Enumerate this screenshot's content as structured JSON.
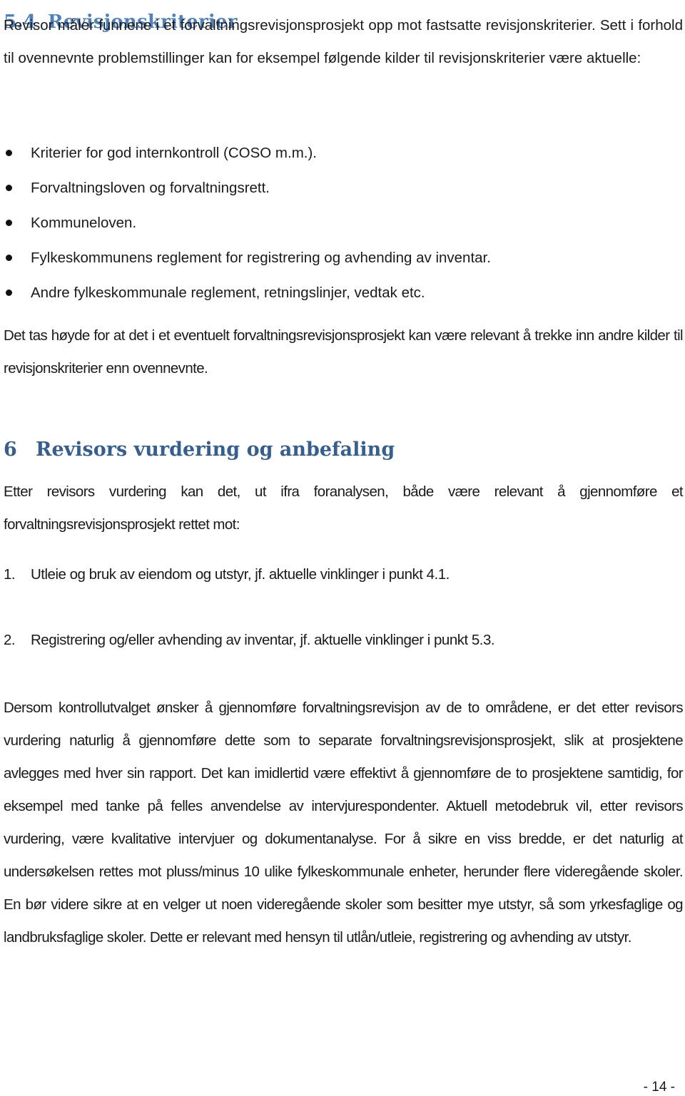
{
  "section_5_4": {
    "number": "5.4",
    "title": "Revisjonskriterier",
    "intro": "Revisor måler funnene i et forvaltningsrevisjonsprosjekt opp mot fastsatte revisjonskriterier. Sett i forhold til ovennevnte problemstillinger kan for eksempel følgende kilder til revisjonskriterier være aktuelle:",
    "bullets": [
      "Kriterier for god internkontroll (COSO m.m.).",
      "Forvaltningsloven og forvaltningsrett.",
      "Kommuneloven.",
      "Fylkeskommunens reglement for registrering og avhending av inventar.",
      "Andre fylkeskommunale reglement, retningslinjer, vedtak etc."
    ],
    "closing": "Det tas høyde for at det i et eventuelt forvaltningsrevisjonsprosjekt kan være relevant å trekke inn andre kilder til revisjonskriterier enn ovennevnte."
  },
  "section_6": {
    "number": "6",
    "title": "Revisors vurdering og anbefaling",
    "intro": "Etter revisors vurdering kan det, ut ifra foranalysen, både være relevant å gjennomføre et forvaltningsrevisjonsprosjekt rettet mot:",
    "items": [
      {
        "num": "1.",
        "text": "Utleie og bruk av eiendom og utstyr, jf. aktuelle vinklinger i punkt 4.1."
      },
      {
        "num": "2.",
        "text": "Registrering og/eller avhending av inventar, jf. aktuelle vinklinger i punkt 5.3."
      }
    ],
    "body": "Dersom kontrollutvalget ønsker å gjennomføre forvaltningsrevisjon av de to områdene, er det etter revisors vurdering naturlig å gjennomføre dette som to separate forvaltningsrevisjonsprosjekt, slik at prosjektene avlegges med hver sin rapport. Det kan imidlertid være effektivt å gjennomføre de to prosjektene samtidig, for eksempel med tanke på felles anvendelse av intervjurespondenter. Aktuell metodebruk vil, etter revisors vurdering, være kvalitative intervjuer og dokumentanalyse. For å sikre en viss bredde, er det naturlig at undersøkelsen rettes mot pluss/minus 10 ulike fylkeskommunale enheter, herunder flere videregående skoler. En bør videre sikre at en velger ut noen videregående skoler som besitter mye utstyr, så som yrkesfaglige og landbruksfaglige skoler. Dette er relevant med hensyn til utlån/utleie, registrering og avhending av utstyr."
  },
  "footer": {
    "page_number": "- 14 -"
  }
}
